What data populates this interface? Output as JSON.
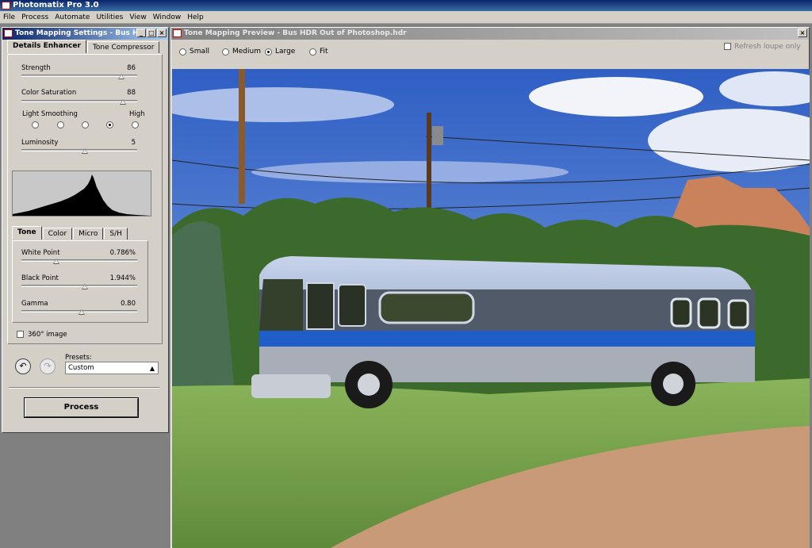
{
  "app": {
    "title": "Photomatix Pro 3.0",
    "menu": [
      "File",
      "Process",
      "Automate",
      "Utilities",
      "View",
      "Window",
      "Help"
    ]
  },
  "settings_window": {
    "title": "Tone Mapping Settings - Bus H...",
    "tabs": [
      "Details Enhancer",
      "Tone Compressor"
    ],
    "active_tab": "Details Enhancer",
    "strength": {
      "label": "Strength",
      "value": "86",
      "level": 0.86
    },
    "color_saturation": {
      "label": "Color Saturation",
      "value": "88",
      "level": 0.88
    },
    "light_smoothing": {
      "label": "Light Smoothing",
      "high_label": "High",
      "options": 5,
      "selected_index": 3
    },
    "luminosity": {
      "label": "Luminosity",
      "value": "5",
      "level": 0.55
    },
    "sub_tabs": [
      "Tone",
      "Color",
      "Micro",
      "S/H"
    ],
    "active_sub_tab": "Tone",
    "white_point": {
      "label": "White Point",
      "value": "0.786%",
      "level": 0.3
    },
    "black_point": {
      "label": "Black Point",
      "value": "1.944%",
      "level": 0.55
    },
    "gamma": {
      "label": "Gamma",
      "value": "0.80",
      "level": 0.52
    },
    "image_360": {
      "label": "360° image",
      "checked": false
    },
    "presets": {
      "label": "Presets:",
      "selected": "Custom"
    },
    "process_label": "Process"
  },
  "preview_window": {
    "title": "Tone Mapping Preview - Bus HDR Out of Photoshop.hdr",
    "size_options": [
      "Small",
      "Medium",
      "Large",
      "Fit"
    ],
    "selected_size": "Large",
    "refresh_loupe": {
      "label": "Refresh loupe only",
      "checked": false
    }
  },
  "colors": {
    "title_active": "#0a246a",
    "title_inactive": "#808080",
    "window_bg": "#d4d0c8",
    "sky": "#3b66c4",
    "bus_stripe": "#1f5ec8"
  },
  "icons": [
    "undo-icon",
    "redo-icon",
    "close-icon",
    "minimize-icon",
    "maximize-icon"
  ]
}
